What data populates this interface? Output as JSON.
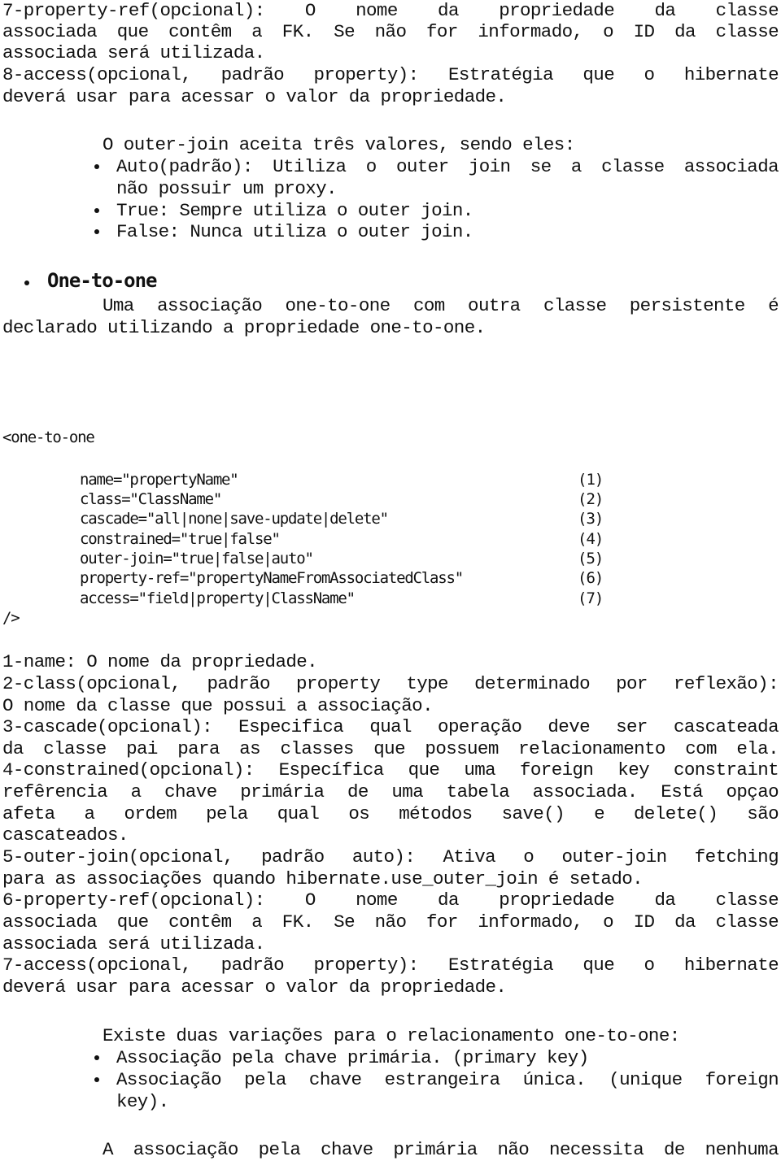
{
  "top": {
    "lines": [
      {
        "text": "7-property-ref(opcional):  O  nome  da  propriedade  da  classe",
        "justify": true
      },
      {
        "text": "associada que contêm a FK. Se não for informado, o ID da classe",
        "justify": true
      },
      {
        "text": "associada será utilizada.",
        "justify": false
      },
      {
        "text": "8-access(opcional, padrão property): Estratégia que o hibernate",
        "justify": true
      },
      {
        "text": "deverá usar para acessar o valor da propriedade.",
        "justify": false
      }
    ]
  },
  "outer_join": {
    "intro": "O outer-join aceita três valores, sendo eles:",
    "items": [
      {
        "line1": "Auto(padrão): Utiliza o outer join se a classe associada",
        "line2": "não possuir um proxy."
      },
      {
        "line1": "True: Sempre utiliza o outer join."
      },
      {
        "line1": "False: Nunca utiliza o outer join."
      }
    ]
  },
  "section": {
    "heading": "One-to-one",
    "para_line1": "Uma associação one-to-one com outra classe persistente é",
    "para_line2": "declarado utilizando a propriedade one-to-one."
  },
  "code": {
    "open_tag": "<one-to-one",
    "attributes": [
      {
        "text": "name=\"propertyName\"",
        "num": "(1)"
      },
      {
        "text": "class=\"ClassName\"",
        "num": "(2)"
      },
      {
        "text": "cascade=\"all|none|save-update|delete\"",
        "num": "(3)"
      },
      {
        "text": "constrained=\"true|false\"",
        "num": "(4)"
      },
      {
        "text": "outer-join=\"true|false|auto\"",
        "num": "(5)"
      },
      {
        "text": "property-ref=\"propertyNameFromAssociatedClass\"",
        "num": "(6)"
      },
      {
        "text": "access=\"field|property|ClassName\"",
        "num": "(7)"
      }
    ],
    "close_tag": "/>"
  },
  "descriptions": {
    "lines": [
      {
        "text": "1-name: O nome da propriedade.",
        "justify": false
      },
      {
        "text": "2-class(opcional, padrão property type determinado por reflexão):",
        "justify": true
      },
      {
        "text": "O nome da classe que possui a associação.",
        "justify": false
      },
      {
        "text": "3-cascade(opcional): Especifica qual operação deve ser cascateada",
        "justify": true
      },
      {
        "text": "da classe pai para as classes que possuem relacionamento com ela.",
        "justify": true
      },
      {
        "text": "4-constrained(opcional): Específica que uma foreign key constraint",
        "justify": true
      },
      {
        "text": "refêrencia a chave primária de uma tabela associada. Está opçao",
        "justify": true
      },
      {
        "text": "afeta a ordem pela qual os métodos save() e delete() são",
        "justify": true
      },
      {
        "text": "cascateados.",
        "justify": false
      },
      {
        "text": "5-outer-join(opcional, padrão auto): Ativa o outer-join fetching",
        "justify": true
      },
      {
        "text": "para as associações quando hibernate.use_outer_join é setado.",
        "justify": false
      },
      {
        "text": "6-property-ref(opcional):  O  nome  da  propriedade  da  classe",
        "justify": true
      },
      {
        "text": "associada que contêm a FK. Se não for informado, o ID da classe",
        "justify": true
      },
      {
        "text": "associada será utilizada.",
        "justify": false
      },
      {
        "text": "7-access(opcional, padrão property): Estratégia que o hibernate",
        "justify": true
      },
      {
        "text": "deverá usar para acessar o valor da propriedade.",
        "justify": false
      }
    ]
  },
  "variations": {
    "intro": "Existe duas variações para o relacionamento one-to-one:",
    "items": [
      {
        "line1": "Associação pela chave primária. (primary key)"
      },
      {
        "line1": "Associação pela chave estrangeira única. (unique foreign",
        "line2": "key)."
      }
    ]
  },
  "closing": {
    "text": "A associação pela chave primária não necessita de nenhuma"
  }
}
